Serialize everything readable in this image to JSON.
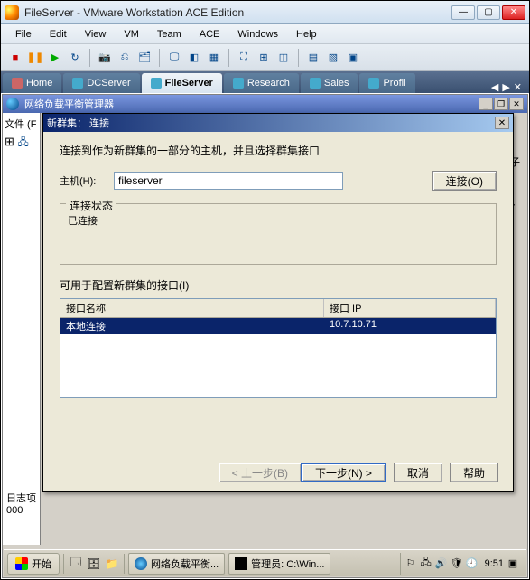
{
  "vmware": {
    "title": "FileServer - VMware Workstation ACE Edition",
    "menu": [
      "File",
      "Edit",
      "View",
      "VM",
      "Team",
      "ACE",
      "Windows",
      "Help"
    ],
    "tabs": [
      {
        "label": "Home",
        "type": "home"
      },
      {
        "label": "DCServer",
        "type": "monitor"
      },
      {
        "label": "FileServer",
        "type": "monitor",
        "active": true
      },
      {
        "label": "Research",
        "type": "monitor"
      },
      {
        "label": "Sales",
        "type": "monitor"
      },
      {
        "label": "Profil",
        "type": "monitor"
      }
    ]
  },
  "nlb": {
    "title": "网络负载平衡管理器",
    "side_file": "文件 (F",
    "bg_column": "集 IP 子",
    "log_label": "日志项",
    "log_index": "000"
  },
  "wizard": {
    "title": "新群集： 连接",
    "instruction": "连接到作为新群集的一部分的主机，并且选择群集接口",
    "host_label": "主机(H):",
    "host_value": "fileserver",
    "connect_btn": "连接(O)",
    "status_group": "连接状态",
    "status_text": "已连接",
    "interfaces_label": "可用于配置新群集的接口(I)",
    "col_name": "接口名称",
    "col_ip": "接口 IP",
    "row_name": "本地连接",
    "row_ip": "10.7.10.71",
    "btn_back": "< 上一步(B)",
    "btn_next": "下一步(N) >",
    "btn_cancel": "取消",
    "btn_help": "帮助"
  },
  "taskbar": {
    "start": "开始",
    "task1": "网络负载平衡...",
    "task2": "管理员: C:\\Win...",
    "time": "9:51"
  }
}
